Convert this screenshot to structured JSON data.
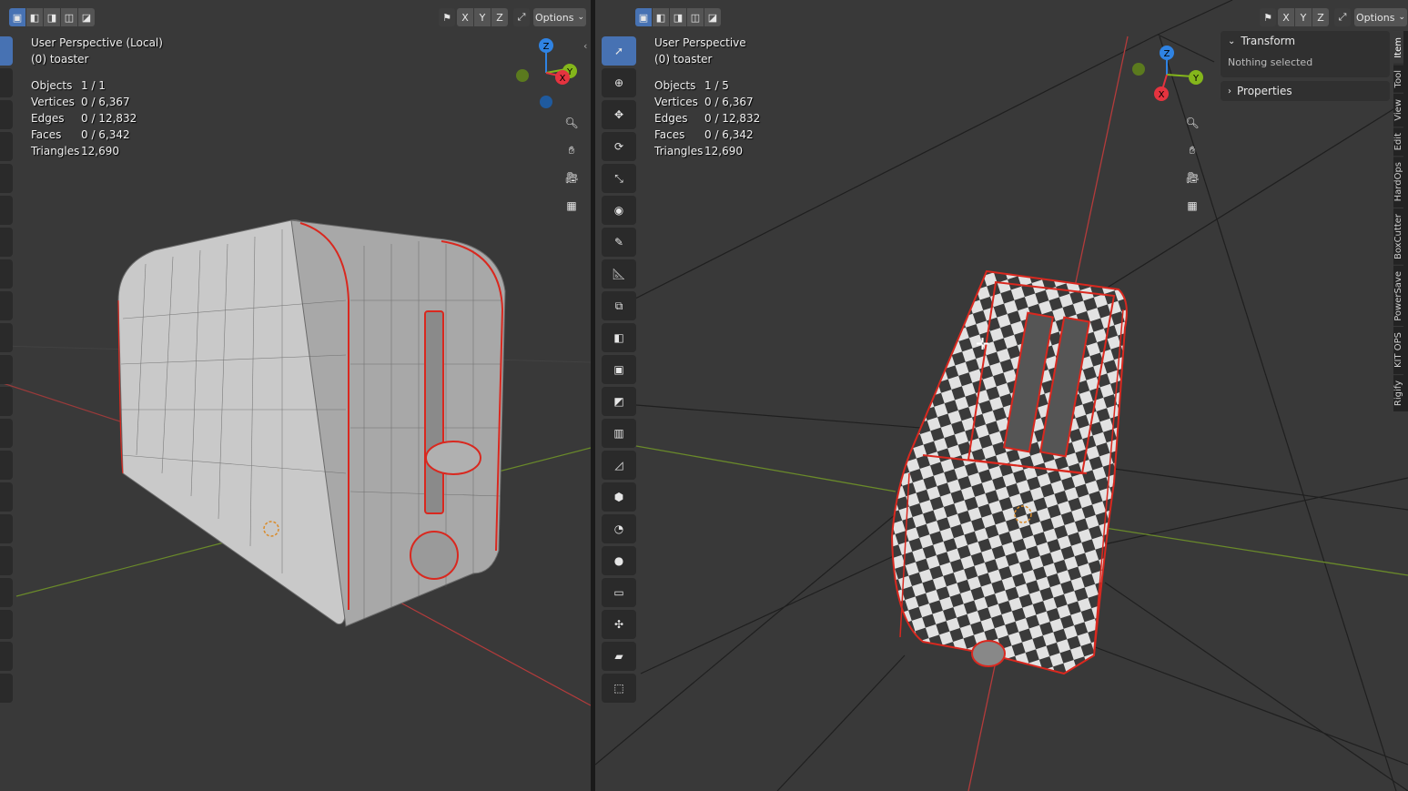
{
  "header": {
    "options_label": "Options",
    "axis_x": "X",
    "axis_y": "Y",
    "axis_z": "Z"
  },
  "left_viewport": {
    "view_name": "User Perspective (Local)",
    "object_line": "(0) toaster",
    "stats": [
      {
        "label": "Objects",
        "value": "1 / 1"
      },
      {
        "label": "Vertices",
        "value": "0 / 6,367"
      },
      {
        "label": "Edges",
        "value": "0 / 12,832"
      },
      {
        "label": "Faces",
        "value": "0 / 6,342"
      },
      {
        "label": "Triangles",
        "value": "12,690"
      }
    ]
  },
  "right_viewport": {
    "view_name": "User Perspective",
    "object_line": "(0) toaster",
    "stats": [
      {
        "label": "Objects",
        "value": "1 / 5"
      },
      {
        "label": "Vertices",
        "value": "0 / 6,367"
      },
      {
        "label": "Edges",
        "value": "0 / 12,832"
      },
      {
        "label": "Faces",
        "value": "0 / 6,342"
      },
      {
        "label": "Triangles",
        "value": "12,690"
      }
    ]
  },
  "gizmo": {
    "x": "X",
    "y": "Y",
    "z": "Z"
  },
  "sidebar": {
    "transform_label": "Transform",
    "transform_empty": "Nothing selected",
    "properties_label": "Properties",
    "tabs": [
      "Item",
      "Tool",
      "View",
      "Edit",
      "HardOps",
      "BoxCutter",
      "PowerSave",
      "KIT OPS",
      "Rigify"
    ]
  },
  "colors": {
    "viewport_bg": "#393939",
    "accent": "#4772b3",
    "x_axis": "#e5333f",
    "y_axis": "#84b61b",
    "z_axis": "#2f83e3",
    "edge_highlight": "#d9281f"
  }
}
